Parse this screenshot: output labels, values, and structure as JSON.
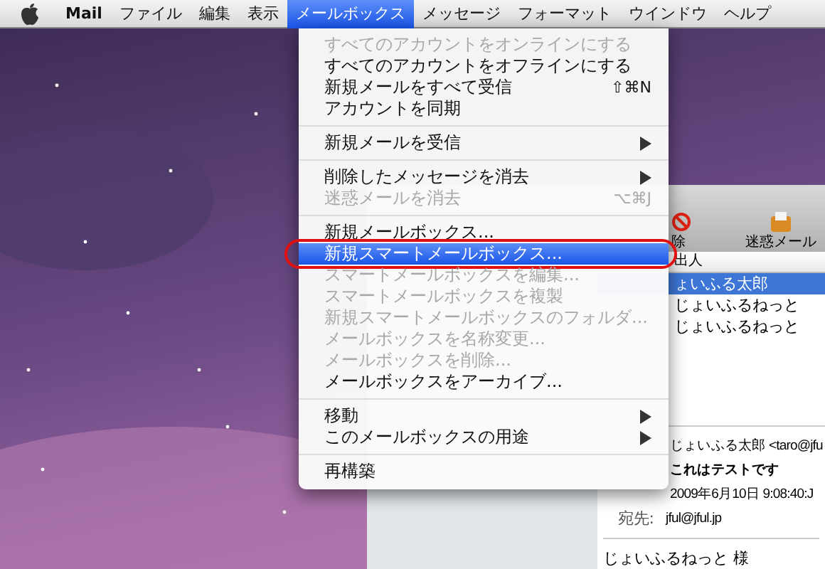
{
  "menubar": {
    "items": [
      {
        "label": "Mail",
        "kind": "app",
        "selected": false
      },
      {
        "label": "ファイル",
        "kind": "menu",
        "selected": false
      },
      {
        "label": "編集",
        "kind": "menu",
        "selected": false
      },
      {
        "label": "表示",
        "kind": "menu",
        "selected": false
      },
      {
        "label": "メールボックス",
        "kind": "menu",
        "selected": true
      },
      {
        "label": "メッセージ",
        "kind": "menu",
        "selected": false
      },
      {
        "label": "フォーマット",
        "kind": "menu",
        "selected": false
      },
      {
        "label": "ウインドウ",
        "kind": "menu",
        "selected": false
      },
      {
        "label": "ヘルプ",
        "kind": "menu",
        "selected": false
      }
    ]
  },
  "menu": {
    "items": [
      {
        "kind": "item",
        "label": "すべてのアカウントをオンラインにする",
        "disabled": true,
        "selected": false
      },
      {
        "kind": "item",
        "label": "すべてのアカウントをオフラインにする",
        "disabled": false,
        "selected": false
      },
      {
        "kind": "item",
        "label": "新規メールをすべて受信",
        "shortcut": "⇧⌘N",
        "disabled": false,
        "selected": false
      },
      {
        "kind": "item",
        "label": "アカウントを同期",
        "disabled": false,
        "selected": false
      },
      {
        "kind": "separator"
      },
      {
        "kind": "item",
        "label": "新規メールを受信",
        "submenu": true,
        "disabled": false,
        "selected": false
      },
      {
        "kind": "separator"
      },
      {
        "kind": "item",
        "label": "削除したメッセージを消去",
        "submenu": true,
        "disabled": false,
        "selected": false
      },
      {
        "kind": "item",
        "label": "迷惑メールを消去",
        "shortcut": "⌥⌘J",
        "disabled": true,
        "selected": false
      },
      {
        "kind": "separator"
      },
      {
        "kind": "item",
        "label": "新規メールボックス...",
        "disabled": false,
        "selected": false
      },
      {
        "kind": "item",
        "label": "新規スマートメールボックス...",
        "disabled": false,
        "selected": true,
        "circled": true
      },
      {
        "kind": "item",
        "label": "スマートメールボックスを編集...",
        "disabled": true,
        "selected": false
      },
      {
        "kind": "item",
        "label": "スマートメールボックスを複製",
        "disabled": true,
        "selected": false
      },
      {
        "kind": "item",
        "label": "新規スマートメールボックスのフォルダ...",
        "disabled": true,
        "selected": false
      },
      {
        "kind": "item",
        "label": "メールボックスを名称変更...",
        "disabled": true,
        "selected": false
      },
      {
        "kind": "item",
        "label": "メールボックスを削除...",
        "disabled": true,
        "selected": false
      },
      {
        "kind": "item",
        "label": "メールボックスをアーカイブ...",
        "disabled": false,
        "selected": false
      },
      {
        "kind": "separator"
      },
      {
        "kind": "item",
        "label": "移動",
        "submenu": true,
        "disabled": false,
        "selected": false
      },
      {
        "kind": "item",
        "label": "このメールボックスの用途",
        "submenu": true,
        "disabled": false,
        "selected": false
      },
      {
        "kind": "separator"
      },
      {
        "kind": "item",
        "label": "再構築",
        "disabled": false,
        "selected": false
      }
    ]
  },
  "mail_window": {
    "toolbar": [
      {
        "label": "除",
        "kind": "delete"
      },
      {
        "label": "迷惑メール",
        "kind": "junk"
      }
    ],
    "list_header": "出人",
    "rows": [
      {
        "sender": "ょいふる太郎",
        "selected": true
      },
      {
        "sender": "じょいふるねっと",
        "selected": false
      },
      {
        "sender": "じょいふるねっと",
        "selected": false
      }
    ],
    "headers": [
      {
        "value": "じょいふる太郎 <taro@jfu",
        "bold": false
      },
      {
        "value": "これはテストです",
        "bold": true
      },
      {
        "value": "2009年6月10日 9:08:40:J",
        "bold": false
      },
      {
        "label": "宛先:",
        "value": "jful@jful.jp",
        "bold": false
      }
    ],
    "body": "じょいふるねっと 様"
  }
}
